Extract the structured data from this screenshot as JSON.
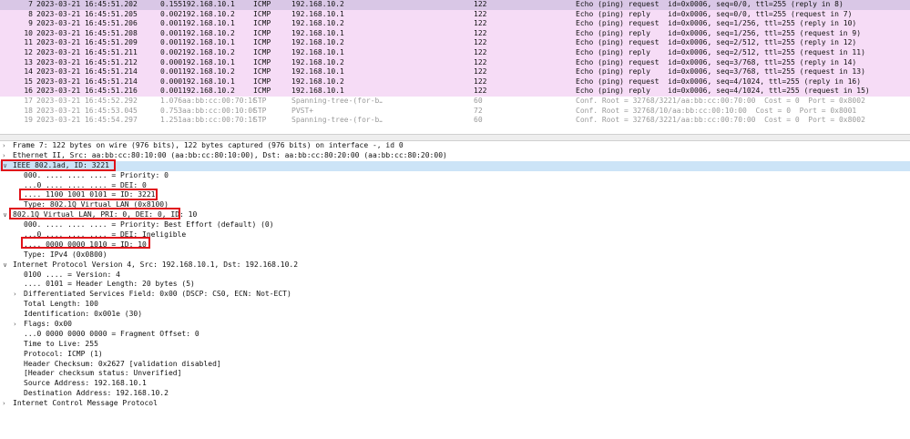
{
  "packets": [
    {
      "no": "7",
      "time": "2023-03-21 16:45:51.202",
      "delta": "0.155",
      "src": "192.168.10.1",
      "proto": "ICMP",
      "dst": "192.168.10.2",
      "len": "122",
      "info": "Echo (ping) request  id=0x0006, seq=0/0, ttl=255 (reply in 8)"
    },
    {
      "no": "8",
      "time": "2023-03-21 16:45:51.205",
      "delta": "0.002",
      "src": "192.168.10.2",
      "proto": "ICMP",
      "dst": "192.168.10.1",
      "len": "122",
      "info": "Echo (ping) reply    id=0x0006, seq=0/0, ttl=255 (request in 7)"
    },
    {
      "no": "9",
      "time": "2023-03-21 16:45:51.206",
      "delta": "0.001",
      "src": "192.168.10.1",
      "proto": "ICMP",
      "dst": "192.168.10.2",
      "len": "122",
      "info": "Echo (ping) request  id=0x0006, seq=1/256, ttl=255 (reply in 10)"
    },
    {
      "no": "10",
      "time": "2023-03-21 16:45:51.208",
      "delta": "0.001",
      "src": "192.168.10.2",
      "proto": "ICMP",
      "dst": "192.168.10.1",
      "len": "122",
      "info": "Echo (ping) reply    id=0x0006, seq=1/256, ttl=255 (request in 9)"
    },
    {
      "no": "11",
      "time": "2023-03-21 16:45:51.209",
      "delta": "0.001",
      "src": "192.168.10.1",
      "proto": "ICMP",
      "dst": "192.168.10.2",
      "len": "122",
      "info": "Echo (ping) request  id=0x0006, seq=2/512, ttl=255 (reply in 12)"
    },
    {
      "no": "12",
      "time": "2023-03-21 16:45:51.211",
      "delta": "0.002",
      "src": "192.168.10.2",
      "proto": "ICMP",
      "dst": "192.168.10.1",
      "len": "122",
      "info": "Echo (ping) reply    id=0x0006, seq=2/512, ttl=255 (request in 11)"
    },
    {
      "no": "13",
      "time": "2023-03-21 16:45:51.212",
      "delta": "0.000",
      "src": "192.168.10.1",
      "proto": "ICMP",
      "dst": "192.168.10.2",
      "len": "122",
      "info": "Echo (ping) request  id=0x0006, seq=3/768, ttl=255 (reply in 14)"
    },
    {
      "no": "14",
      "time": "2023-03-21 16:45:51.214",
      "delta": "0.001",
      "src": "192.168.10.2",
      "proto": "ICMP",
      "dst": "192.168.10.1",
      "len": "122",
      "info": "Echo (ping) reply    id=0x0006, seq=3/768, ttl=255 (request in 13)"
    },
    {
      "no": "15",
      "time": "2023-03-21 16:45:51.214",
      "delta": "0.000",
      "src": "192.168.10.1",
      "proto": "ICMP",
      "dst": "192.168.10.2",
      "len": "122",
      "info": "Echo (ping) request  id=0x0006, seq=4/1024, ttl=255 (reply in 16)"
    },
    {
      "no": "16",
      "time": "2023-03-21 16:45:51.216",
      "delta": "0.001",
      "src": "192.168.10.2",
      "proto": "ICMP",
      "dst": "192.168.10.1",
      "len": "122",
      "info": "Echo (ping) reply    id=0x0006, seq=4/1024, ttl=255 (request in 15)"
    },
    {
      "no": "17",
      "time": "2023-03-21 16:45:52.292",
      "delta": "1.076",
      "src": "aa:bb:cc:00:70:10",
      "proto": "STP",
      "dst": "Spanning-tree-(for-b…",
      "len": "60",
      "info": "Conf. Root = 32768/3221/aa:bb:cc:00:70:00  Cost = 0  Port = 0x8002"
    },
    {
      "no": "18",
      "time": "2023-03-21 16:45:53.045",
      "delta": "0.753",
      "src": "aa:bb:cc:00:10:00",
      "proto": "STP",
      "dst": "PVST+",
      "len": "72",
      "info": "Conf. Root = 32768/10/aa:bb:cc:00:10:00  Cost = 0  Port = 0x8001"
    },
    {
      "no": "19",
      "time": "2023-03-21 16:45:54.297",
      "delta": "1.251",
      "src": "aa:bb:cc:00:70:10",
      "proto": "STP",
      "dst": "Spanning-tree-(for-b…",
      "len": "60",
      "info": "Conf. Root = 32768/3221/aa:bb:cc:00:70:00  Cost = 0  Port = 0x8002"
    }
  ],
  "details": [
    {
      "level": 0,
      "expander": ">",
      "text": "Frame 7: 122 bytes on wire (976 bits), 122 bytes captured (976 bits) on interface -, id 0"
    },
    {
      "level": 0,
      "expander": ">",
      "text": "Ethernet II, Src: aa:bb:cc:80:10:00 (aa:bb:cc:80:10:00), Dst: aa:bb:cc:80:20:00 (aa:bb:cc:80:20:00)"
    },
    {
      "level": 0,
      "expander": "v",
      "text": "IEEE 802.1ad, ID: 3221"
    },
    {
      "level": 1,
      "expander": "",
      "text": "000. .... .... .... = Priority: 0"
    },
    {
      "level": 1,
      "expander": "",
      "text": "...0 .... .... .... = DEI: 0"
    },
    {
      "level": 1,
      "expander": "",
      "text": ".... 1100 1001 0101 = ID: 3221"
    },
    {
      "level": 1,
      "expander": "",
      "text": "Type: 802.1Q Virtual LAN (0x8100)"
    },
    {
      "level": 0,
      "expander": "v",
      "text": "802.1Q Virtual LAN, PRI: 0, DEI: 0, ID: 10"
    },
    {
      "level": 1,
      "expander": "",
      "text": "000. .... .... .... = Priority: Best Effort (default) (0)"
    },
    {
      "level": 1,
      "expander": "",
      "text": "...0 .... .... .... = DEI: Ineligible"
    },
    {
      "level": 1,
      "expander": "",
      "text": ".... 0000 0000 1010 = ID: 10"
    },
    {
      "level": 1,
      "expander": "",
      "text": "Type: IPv4 (0x0800)"
    },
    {
      "level": 0,
      "expander": "v",
      "text": "Internet Protocol Version 4, Src: 192.168.10.1, Dst: 192.168.10.2"
    },
    {
      "level": 1,
      "expander": "",
      "text": "0100 .... = Version: 4"
    },
    {
      "level": 1,
      "expander": "",
      "text": ".... 0101 = Header Length: 20 bytes (5)"
    },
    {
      "level": 1,
      "expander": ">",
      "text": "Differentiated Services Field: 0x00 (DSCP: CS0, ECN: Not-ECT)"
    },
    {
      "level": 1,
      "expander": "",
      "text": "Total Length: 100"
    },
    {
      "level": 1,
      "expander": "",
      "text": "Identification: 0x001e (30)"
    },
    {
      "level": 1,
      "expander": ">",
      "text": "Flags: 0x00"
    },
    {
      "level": 1,
      "expander": "",
      "text": "...0 0000 0000 0000 = Fragment Offset: 0"
    },
    {
      "level": 1,
      "expander": "",
      "text": "Time to Live: 255"
    },
    {
      "level": 1,
      "expander": "",
      "text": "Protocol: ICMP (1)"
    },
    {
      "level": 1,
      "expander": "",
      "text": "Header Checksum: 0x2627 [validation disabled]"
    },
    {
      "level": 1,
      "expander": "",
      "text": "[Header checksum status: Unverified]"
    },
    {
      "level": 1,
      "expander": "",
      "text": "Source Address: 192.168.10.1"
    },
    {
      "level": 1,
      "expander": "",
      "text": "Destination Address: 192.168.10.2"
    },
    {
      "level": 0,
      "expander": ">",
      "text": "Internet Control Message Protocol"
    }
  ],
  "colors": {
    "icmp_row": "#f6dcf6",
    "selected_row": "#d9c7e6",
    "stp_text": "#9a9a9a",
    "detail_selected": "#cce4f7",
    "highlight_box": "#e0121a"
  }
}
